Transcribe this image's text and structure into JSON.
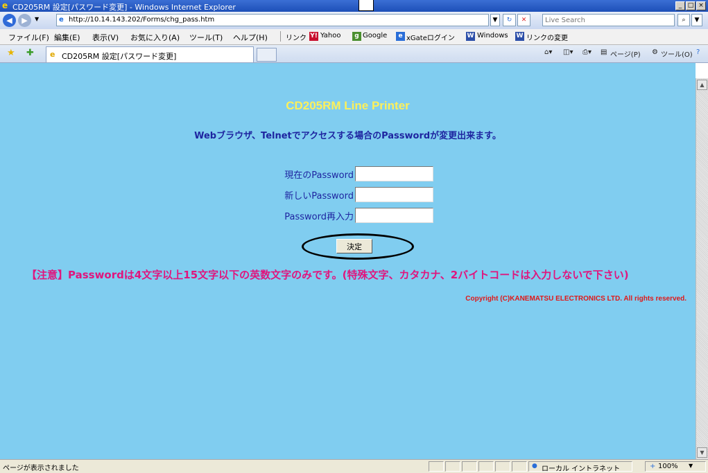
{
  "window": {
    "title": "CD205RM 設定[パスワード変更] - Windows Internet Explorer"
  },
  "address": {
    "url": "http://10.14.143.202/Forms/chg_pass.htm",
    "search_placeholder": "Live Search"
  },
  "menu": [
    "ファイル(F)",
    "編集(E)",
    "表示(V)",
    "お気に入り(A)",
    "ツール(T)",
    "ヘルプ(H)"
  ],
  "links": {
    "label": "リンク",
    "items": [
      "Yahoo",
      "Google",
      "xGateログイン",
      "Windows",
      "リンクの変更"
    ]
  },
  "tab": {
    "title": "CD205RM 設定[パスワード変更]"
  },
  "commands": {
    "page": "ページ(P)",
    "tools": "ツール(O)"
  },
  "page": {
    "heading": "CD205RM Line Printer",
    "description": "Webブラウザ、Telnetでアクセスする場合のPasswordが変更出来ます。",
    "fields": [
      {
        "label": "現在のPassword",
        "value": ""
      },
      {
        "label": "新しいPassword",
        "value": ""
      },
      {
        "label": "Password再入力",
        "value": ""
      }
    ],
    "submit_label": "決定",
    "notice": "【注意】Passwordは4文字以上15文字以下の英数文字のみです。(特殊文字、カタカナ、2バイトコードは入力しないで下さい)",
    "copyright": "Copyright (C)KANEMATSU ELECTRONICS LTD. All rights reserved."
  },
  "status": {
    "text": "ページが表示されました",
    "zone": "ローカル イントラネット",
    "zoom": "100%"
  }
}
